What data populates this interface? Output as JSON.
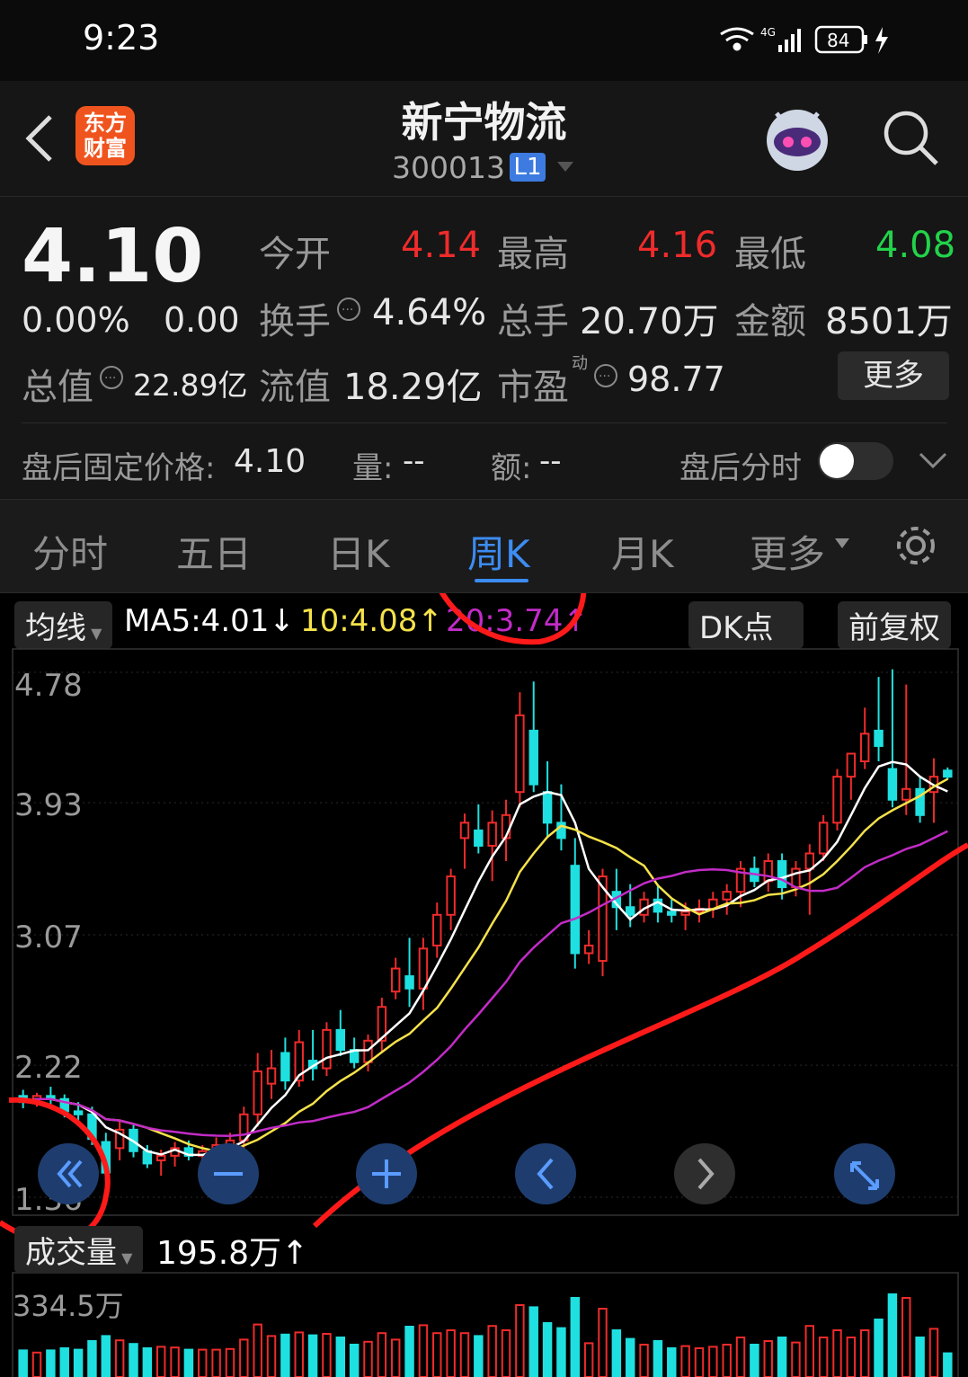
{
  "status_bar": {
    "time": "9:23",
    "network": "4G",
    "battery": "84"
  },
  "header": {
    "app_logo": "东方\n财富",
    "stock_name": "新宁物流",
    "stock_code": "300013",
    "level_badge": "L1"
  },
  "quote": {
    "price": "4.10",
    "change_pct": "0.00%",
    "change": "0.00",
    "open_label": "今开",
    "open": "4.14",
    "high_label": "最高",
    "high": "4.16",
    "low_label": "最低",
    "low": "4.08",
    "turnover_label": "换手",
    "turnover": "4.64%",
    "volume_label": "总手",
    "volume": "20.70万",
    "amount_label": "金额",
    "amount": "8501万",
    "total_mv_label": "总值",
    "total_mv": "22.89亿",
    "float_mv_label": "流值",
    "float_mv": "18.29亿",
    "pe_label": "市盈",
    "pe_superscript": "动",
    "pe": "98.77",
    "more_button": "更多",
    "after_hours_label": "盘后固定价格:",
    "after_hours_price": "4.10",
    "ah_volume_label": "量:",
    "ah_volume": "--",
    "ah_amount_label": "额:",
    "ah_amount": "--",
    "ah_timeshare_label": "盘后分时"
  },
  "tabs": [
    "分时",
    "五日",
    "日K",
    "周K",
    "月K",
    "更多"
  ],
  "active_tab": "周K",
  "indicators": {
    "ma_selector": "均线",
    "ma5": "MA5:4.01↓",
    "ma10": "10:4.08↑",
    "ma20": "20:3.74↑",
    "dk_button": "DK点",
    "adjust_button": "前复权"
  },
  "y_axis": [
    "4.78",
    "3.93",
    "3.07",
    "2.22",
    "1.36"
  ],
  "volume": {
    "selector": "成交量",
    "value": "195.8万↑",
    "max_label": "334.5万"
  },
  "colors": {
    "up": "#ef2b2b",
    "down": "#1fe0e0",
    "ma5": "#ffffff",
    "ma10": "#f5e24a",
    "ma20": "#c22bc7",
    "accent": "#3c8cf2"
  },
  "chart_data": {
    "type": "candlestick",
    "ylim": [
      1.36,
      4.78
    ],
    "ohlc": [
      [
        2.02,
        2.06,
        1.94,
        1.98
      ],
      [
        2.0,
        2.04,
        1.95,
        2.02
      ],
      [
        2.02,
        2.08,
        1.96,
        2.0
      ],
      [
        2.0,
        2.03,
        1.88,
        1.92
      ],
      [
        1.92,
        1.98,
        1.85,
        1.9
      ],
      [
        1.9,
        1.95,
        1.7,
        1.74
      ],
      [
        1.72,
        1.78,
        1.46,
        1.52
      ],
      [
        1.68,
        1.86,
        1.6,
        1.8
      ],
      [
        1.8,
        1.83,
        1.62,
        1.66
      ],
      [
        1.66,
        1.7,
        1.55,
        1.58
      ],
      [
        1.6,
        1.67,
        1.5,
        1.63
      ],
      [
        1.63,
        1.72,
        1.56,
        1.68
      ],
      [
        1.68,
        1.73,
        1.6,
        1.63
      ],
      [
        1.63,
        1.7,
        1.57,
        1.66
      ],
      [
        1.66,
        1.75,
        1.62,
        1.7
      ],
      [
        1.7,
        1.78,
        1.64,
        1.73
      ],
      [
        1.73,
        1.95,
        1.68,
        1.9
      ],
      [
        1.9,
        2.3,
        1.82,
        2.18
      ],
      [
        2.1,
        2.32,
        2.0,
        2.2
      ],
      [
        2.3,
        2.4,
        2.06,
        2.12
      ],
      [
        2.12,
        2.45,
        2.08,
        2.37
      ],
      [
        2.25,
        2.45,
        2.12,
        2.2
      ],
      [
        2.2,
        2.5,
        2.15,
        2.45
      ],
      [
        2.45,
        2.58,
        2.28,
        2.32
      ],
      [
        2.32,
        2.4,
        2.2,
        2.24
      ],
      [
        2.24,
        2.42,
        2.18,
        2.38
      ],
      [
        2.38,
        2.66,
        2.3,
        2.6
      ],
      [
        2.7,
        2.92,
        2.65,
        2.85
      ],
      [
        2.8,
        3.05,
        2.6,
        2.72
      ],
      [
        2.72,
        3.05,
        2.58,
        2.98
      ],
      [
        3.0,
        3.28,
        2.92,
        3.2
      ],
      [
        3.2,
        3.5,
        3.1,
        3.45
      ],
      [
        3.7,
        3.86,
        3.5,
        3.8
      ],
      [
        3.75,
        3.92,
        3.6,
        3.65
      ],
      [
        3.65,
        3.88,
        3.42,
        3.8
      ],
      [
        3.7,
        3.95,
        3.55,
        3.85
      ],
      [
        4.0,
        4.65,
        3.9,
        4.5
      ],
      [
        4.4,
        4.72,
        4.0,
        4.05
      ],
      [
        4.0,
        4.2,
        3.7,
        3.8
      ],
      [
        3.8,
        4.05,
        3.62,
        3.7
      ],
      [
        3.52,
        3.7,
        2.85,
        2.95
      ],
      [
        2.95,
        3.1,
        2.88,
        3.0
      ],
      [
        2.9,
        3.5,
        2.8,
        3.45
      ],
      [
        3.35,
        3.5,
        3.1,
        3.25
      ],
      [
        3.25,
        3.4,
        3.12,
        3.2
      ],
      [
        3.2,
        3.35,
        3.15,
        3.3
      ],
      [
        3.3,
        3.4,
        3.15,
        3.22
      ],
      [
        3.22,
        3.3,
        3.15,
        3.2
      ],
      [
        3.2,
        3.28,
        3.1,
        3.22
      ],
      [
        3.22,
        3.3,
        3.15,
        3.24
      ],
      [
        3.24,
        3.35,
        3.18,
        3.3
      ],
      [
        3.3,
        3.4,
        3.2,
        3.35
      ],
      [
        3.35,
        3.55,
        3.25,
        3.5
      ],
      [
        3.5,
        3.58,
        3.38,
        3.42
      ],
      [
        3.42,
        3.6,
        3.35,
        3.55
      ],
      [
        3.55,
        3.6,
        3.3,
        3.38
      ],
      [
        3.38,
        3.55,
        3.32,
        3.5
      ],
      [
        3.5,
        3.66,
        3.2,
        3.6
      ],
      [
        3.6,
        3.85,
        3.55,
        3.8
      ],
      [
        3.8,
        4.15,
        3.75,
        4.1
      ],
      [
        4.1,
        4.25,
        3.95,
        4.25
      ],
      [
        4.2,
        4.55,
        4.15,
        4.38
      ],
      [
        4.4,
        4.75,
        4.2,
        4.3
      ],
      [
        4.15,
        4.8,
        3.9,
        3.95
      ],
      [
        3.95,
        4.7,
        3.85,
        4.02
      ],
      [
        4.02,
        4.1,
        3.8,
        3.85
      ],
      [
        4.0,
        4.22,
        3.8,
        4.1
      ],
      [
        4.14,
        4.16,
        4.08,
        4.1
      ]
    ]
  }
}
